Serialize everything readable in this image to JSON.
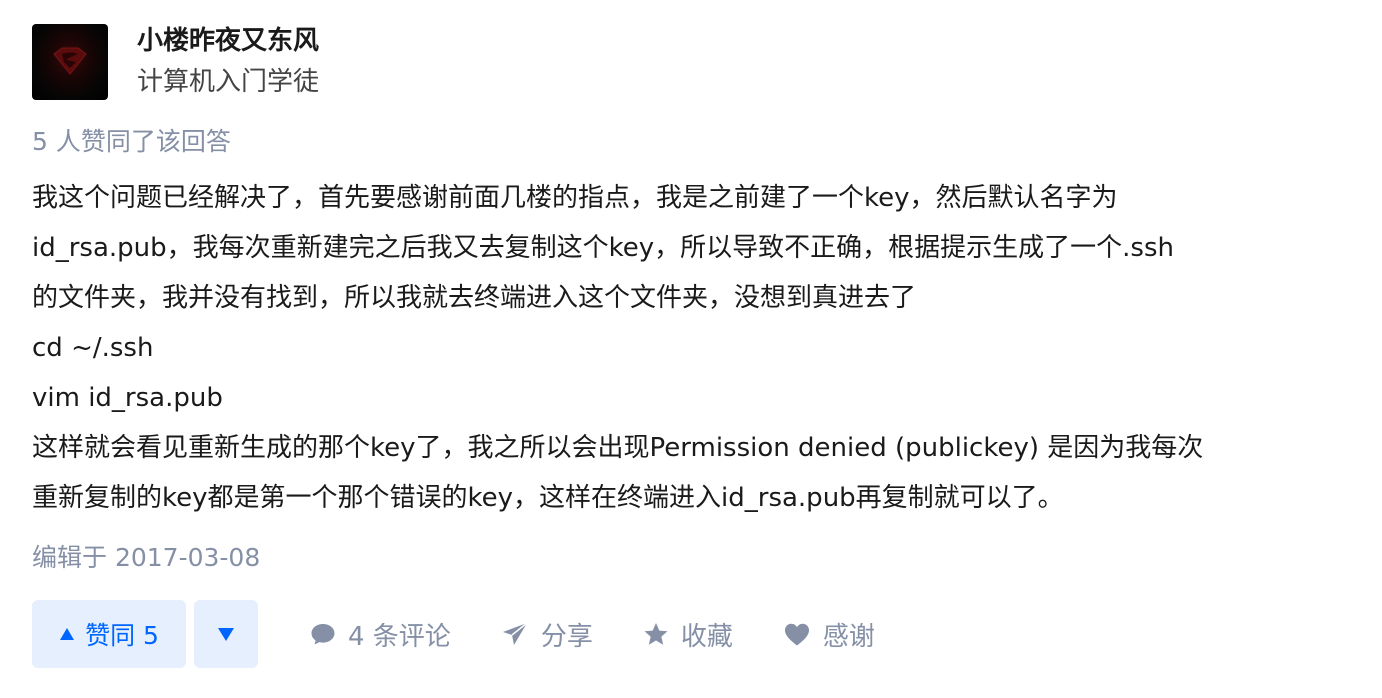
{
  "author": {
    "name": "小楼昨夜又东风",
    "headline": "计算机入门学徒",
    "avatar_icon": "superman-logo-avatar"
  },
  "voters_text": "5 人赞同了该回答",
  "content": {
    "lines": [
      "我这个问题已经解决了，首先要感谢前面几楼的指点，我是之前建了一个key，然后默认名字为",
      "id_rsa.pub，我每次重新建完之后我又去复制这个key，所以导致不正确，根据提示生成了一个.ssh",
      "的文件夹，我并没有找到，所以我就去终端进入这个文件夹，没想到真进去了",
      "cd ~/.ssh",
      "vim id_rsa.pub",
      "这样就会看见重新生成的那个key了，我之所以会出现Permission denied (publickey) 是因为我每次",
      "重新复制的key都是第一个那个错误的key，这样在终端进入id_rsa.pub再复制就可以了。"
    ]
  },
  "edited": "编辑于 2017-03-08",
  "actions": {
    "vote_up_label": "赞同 5",
    "comments_label": "4 条评论",
    "share_label": "分享",
    "favorite_label": "收藏",
    "thanks_label": "感谢"
  },
  "colors": {
    "brand_blue": "#0066ff",
    "vote_bg": "#e5effd",
    "meta_gray": "#8590a6",
    "text": "#1a1a1a"
  }
}
